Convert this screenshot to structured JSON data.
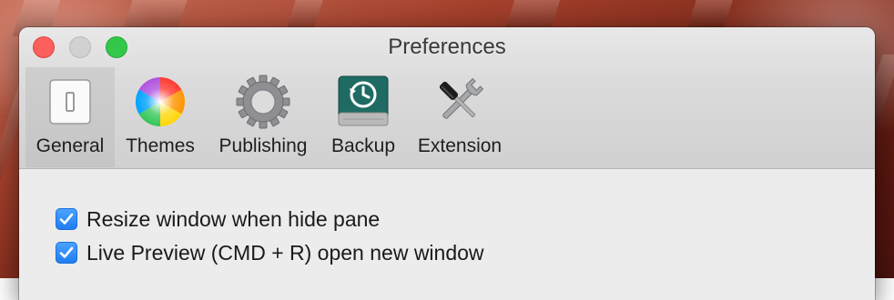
{
  "window": {
    "title": "Preferences"
  },
  "toolbar": {
    "items": [
      {
        "label": "General",
        "icon": "switch-icon",
        "selected": true
      },
      {
        "label": "Themes",
        "icon": "color-wheel-icon",
        "selected": false
      },
      {
        "label": "Publishing",
        "icon": "gear-icon",
        "selected": false
      },
      {
        "label": "Backup",
        "icon": "time-machine-drive-icon",
        "selected": false
      },
      {
        "label": "Extension",
        "icon": "tools-icon",
        "selected": false
      }
    ]
  },
  "general": {
    "options": [
      {
        "label": "Resize window when hide pane",
        "checked": true
      },
      {
        "label": "Live Preview (CMD + R) open new window",
        "checked": true
      }
    ]
  },
  "colors": {
    "checkbox_accent": "#1f7df2",
    "close_button": "#fc605c",
    "minimize_button": "#d1d1d1",
    "maximize_button": "#34c84a"
  }
}
